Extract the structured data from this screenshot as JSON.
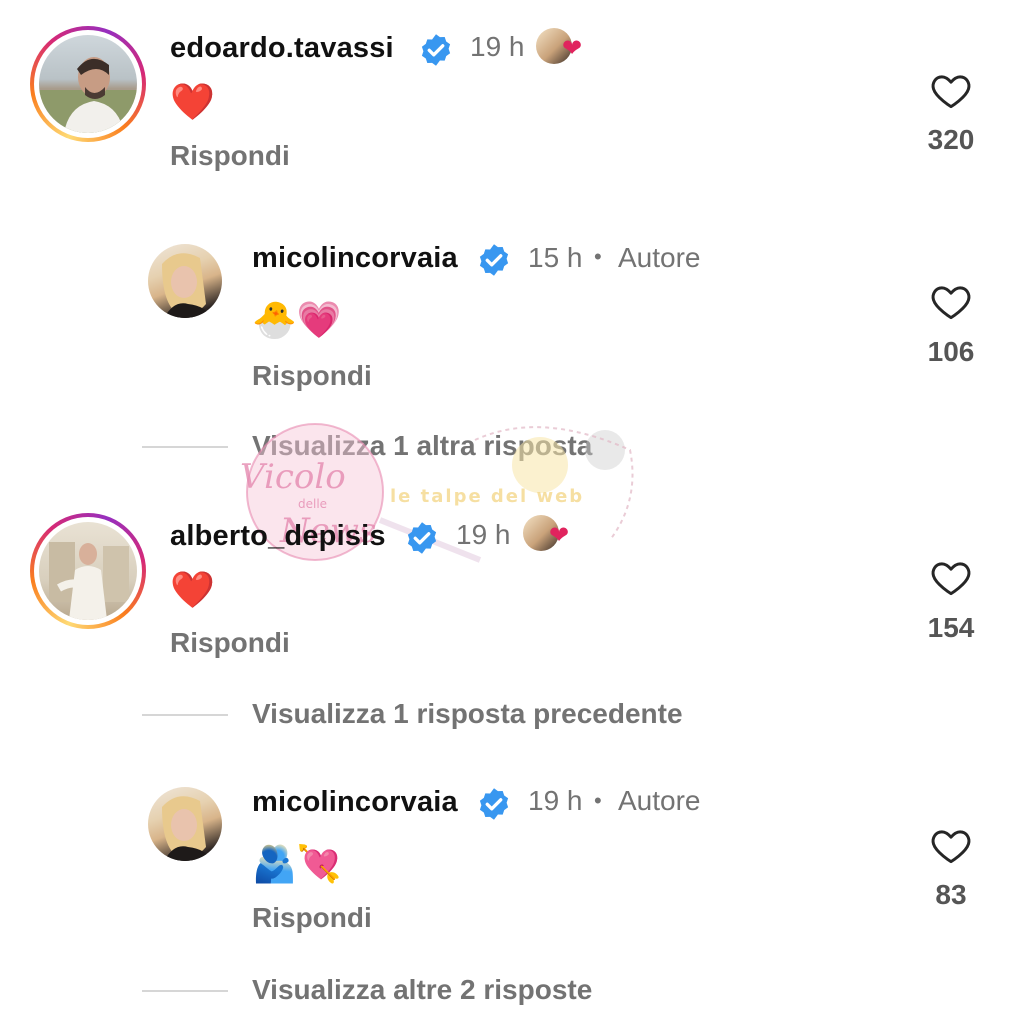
{
  "comments": [
    {
      "username": "edoardo.tavassi",
      "time": "19 h",
      "text": "❤️",
      "reply_label": "Rispondi",
      "likes": "320",
      "liked_by_author": true
    },
    {
      "username": "micolincorvaia",
      "time": "15 h",
      "separator": "•",
      "badge": "Autore",
      "text": "🐣💗",
      "reply_label": "Rispondi",
      "likes": "106"
    },
    {
      "view_more": "Visualizza 1 altra risposta"
    },
    {
      "username": "alberto_depisis",
      "time": "19 h",
      "text": "❤️",
      "reply_label": "Rispondi",
      "likes": "154",
      "liked_by_author": true
    },
    {
      "view_more": "Visualizza 1 risposta precedente"
    },
    {
      "username": "micolincorvaia",
      "time": "19 h",
      "separator": "•",
      "badge": "Autore",
      "text": "🫂💘",
      "reply_label": "Rispondi",
      "likes": "83"
    },
    {
      "view_more": "Visualizza altre 2 risposte"
    }
  ],
  "watermark": {
    "script_text": "Vicolo delle News",
    "caption_text": "le talpe del web"
  },
  "colors": {
    "verified": "#3897f0",
    "secondary_text": "#737373",
    "heart_red": "#e0245e"
  },
  "icons": {
    "verified": "verified-badge-icon",
    "like": "heart-outline-icon",
    "liked_by_author": "author-heart-icon"
  }
}
